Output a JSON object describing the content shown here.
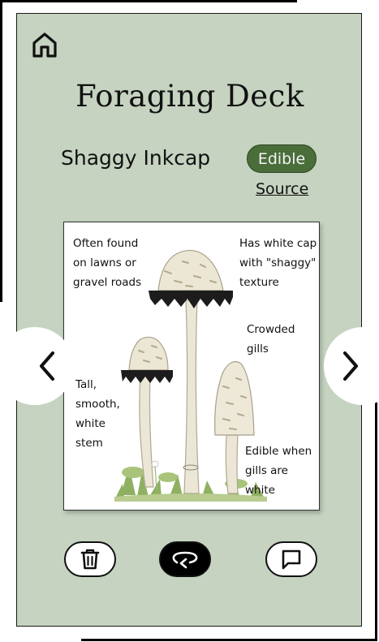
{
  "header": {
    "title": "Foraging Deck"
  },
  "card": {
    "species": "Shaggy Inkcap",
    "badge": "Edible",
    "source_link": "Source",
    "notes": [
      "Often found\non lawns or\ngravel roads",
      "Has white cap\nwith \"shaggy\"\ntexture",
      "Crowded gills",
      "Tall,\nsmooth,\nwhite\nstem",
      "Edible when\ngills are white"
    ]
  },
  "icons": {
    "home": "home-icon",
    "prev": "chevron-left-icon",
    "next": "chevron-right-icon",
    "delete": "trash-icon",
    "flip": "flip-card-icon",
    "comment": "comment-icon"
  },
  "colors": {
    "background": "#c5d3c0",
    "badge": "#4a6e3a",
    "flip_button": "#000000"
  }
}
